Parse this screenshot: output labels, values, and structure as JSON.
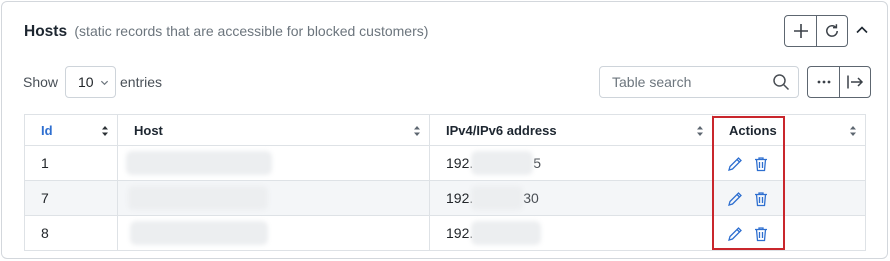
{
  "header": {
    "title": "Hosts",
    "subtitle": "(static records that are accessible for blocked customers)",
    "add_icon": "plus-icon",
    "refresh_icon": "refresh-icon",
    "collapse_icon": "chevron-up-icon"
  },
  "controls": {
    "show_label": "Show",
    "entries_value": "10",
    "entries_label": "entries",
    "search_placeholder": "Table search",
    "more_icon": "ellipsis-icon",
    "export_icon": "arrow-to-right-icon"
  },
  "table": {
    "columns": [
      "Id",
      "Host",
      "IPv4/IPv6 address",
      "Actions"
    ],
    "rows": [
      {
        "id": "1",
        "host": "",
        "ip_prefix": "192.",
        "ip_suffix": "5"
      },
      {
        "id": "7",
        "host": "",
        "ip_prefix": "192.",
        "ip_suffix": "30"
      },
      {
        "id": "8",
        "host": "",
        "ip_prefix": "192.",
        "ip_suffix": ""
      }
    ]
  },
  "colors": {
    "accent": "#2e6fd0",
    "highlight": "#c9262c"
  }
}
